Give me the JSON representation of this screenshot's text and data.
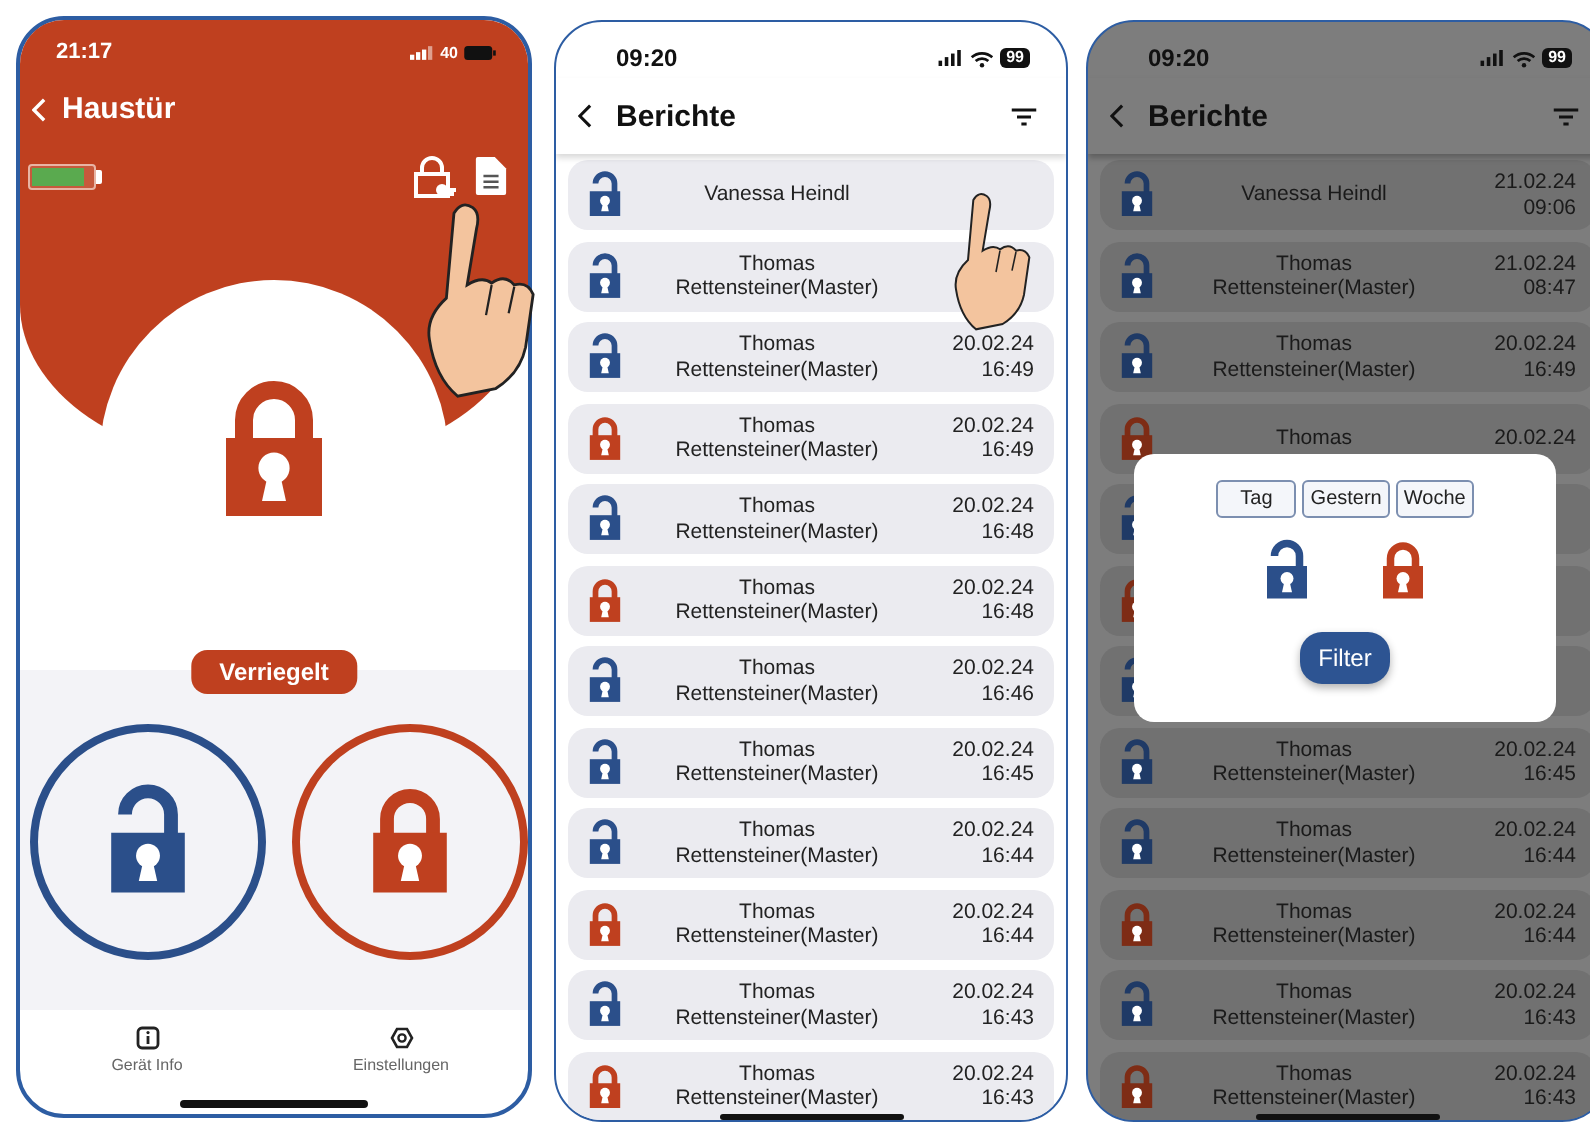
{
  "device_screen": {
    "status_bar": {
      "time": "21:17",
      "battery": "40"
    },
    "title": "Haustür",
    "battery": {
      "level": 0.85
    },
    "locked": true,
    "status": "Verriegelt",
    "tabs": [
      {
        "label": "Gerät Info",
        "kind": "info"
      },
      {
        "label": "Einstellungen",
        "kind": "settings"
      }
    ]
  },
  "reports_screen": {
    "status_bar": {
      "time": "09:20",
      "battery": "99"
    },
    "title": "Berichte",
    "rows": [
      {
        "locked": false,
        "name": "Vanessa Heindl"
      },
      {
        "locked": false,
        "name": "Thomas Rettensteiner(Master)"
      },
      {
        "locked": false,
        "name": "Thomas Rettensteiner(Master)",
        "date": "20.02.24",
        "time": "16:49"
      },
      {
        "locked": true,
        "name": "Thomas Rettensteiner(Master)",
        "date": "20.02.24",
        "time": "16:49"
      },
      {
        "locked": false,
        "name": "Thomas Rettensteiner(Master)",
        "date": "20.02.24",
        "time": "16:48"
      },
      {
        "locked": true,
        "name": "Thomas Rettensteiner(Master)",
        "date": "20.02.24",
        "time": "16:48"
      },
      {
        "locked": false,
        "name": "Thomas Rettensteiner(Master)",
        "date": "20.02.24",
        "time": "16:46"
      },
      {
        "locked": false,
        "name": "Thomas Rettensteiner(Master)",
        "date": "20.02.24",
        "time": "16:45"
      },
      {
        "locked": false,
        "name": "Thomas Rettensteiner(Master)",
        "date": "20.02.24",
        "time": "16:44"
      },
      {
        "locked": true,
        "name": "Thomas Rettensteiner(Master)",
        "date": "20.02.24",
        "time": "16:44"
      },
      {
        "locked": false,
        "name": "Thomas Rettensteiner(Master)",
        "date": "20.02.24",
        "time": "16:43"
      },
      {
        "locked": true,
        "name": "Thomas Rettensteiner(Master)",
        "date": "20.02.24",
        "time": "16:43"
      }
    ]
  },
  "filter_screen": {
    "status_bar": {
      "time": "09:20",
      "battery": "99"
    },
    "title": "Berichte",
    "rows": [
      {
        "locked": false,
        "name": "Vanessa Heindl",
        "date": "21.02.24",
        "time": "09:06"
      },
      {
        "locked": false,
        "name": "Thomas Rettensteiner(Master)",
        "date": "21.02.24",
        "time": "08:47"
      },
      {
        "locked": false,
        "name": "Thomas Rettensteiner(Master)",
        "date": "20.02.24",
        "time": "16:49"
      },
      {
        "locked": true,
        "name": "Thomas",
        "date": "20.02.24"
      },
      {
        "locked": false
      },
      {
        "locked": true
      },
      {
        "locked": false
      },
      {
        "locked": false,
        "name": "Thomas Rettensteiner(Master)",
        "date": "20.02.24",
        "time": "16:45"
      },
      {
        "locked": false,
        "name": "Thomas Rettensteiner(Master)",
        "date": "20.02.24",
        "time": "16:44"
      },
      {
        "locked": true,
        "name": "Thomas Rettensteiner(Master)",
        "date": "20.02.24",
        "time": "16:44"
      },
      {
        "locked": false,
        "name": "Thomas Rettensteiner(Master)",
        "date": "20.02.24",
        "time": "16:43"
      },
      {
        "locked": true,
        "name": "Thomas Rettensteiner(Master)",
        "date": "20.02.24",
        "time": "16:43"
      }
    ],
    "filter_dialog": {
      "options": [
        {
          "label": "Tag"
        },
        {
          "label": "Gestern"
        },
        {
          "label": "Woche"
        }
      ],
      "button": "Filter"
    }
  }
}
